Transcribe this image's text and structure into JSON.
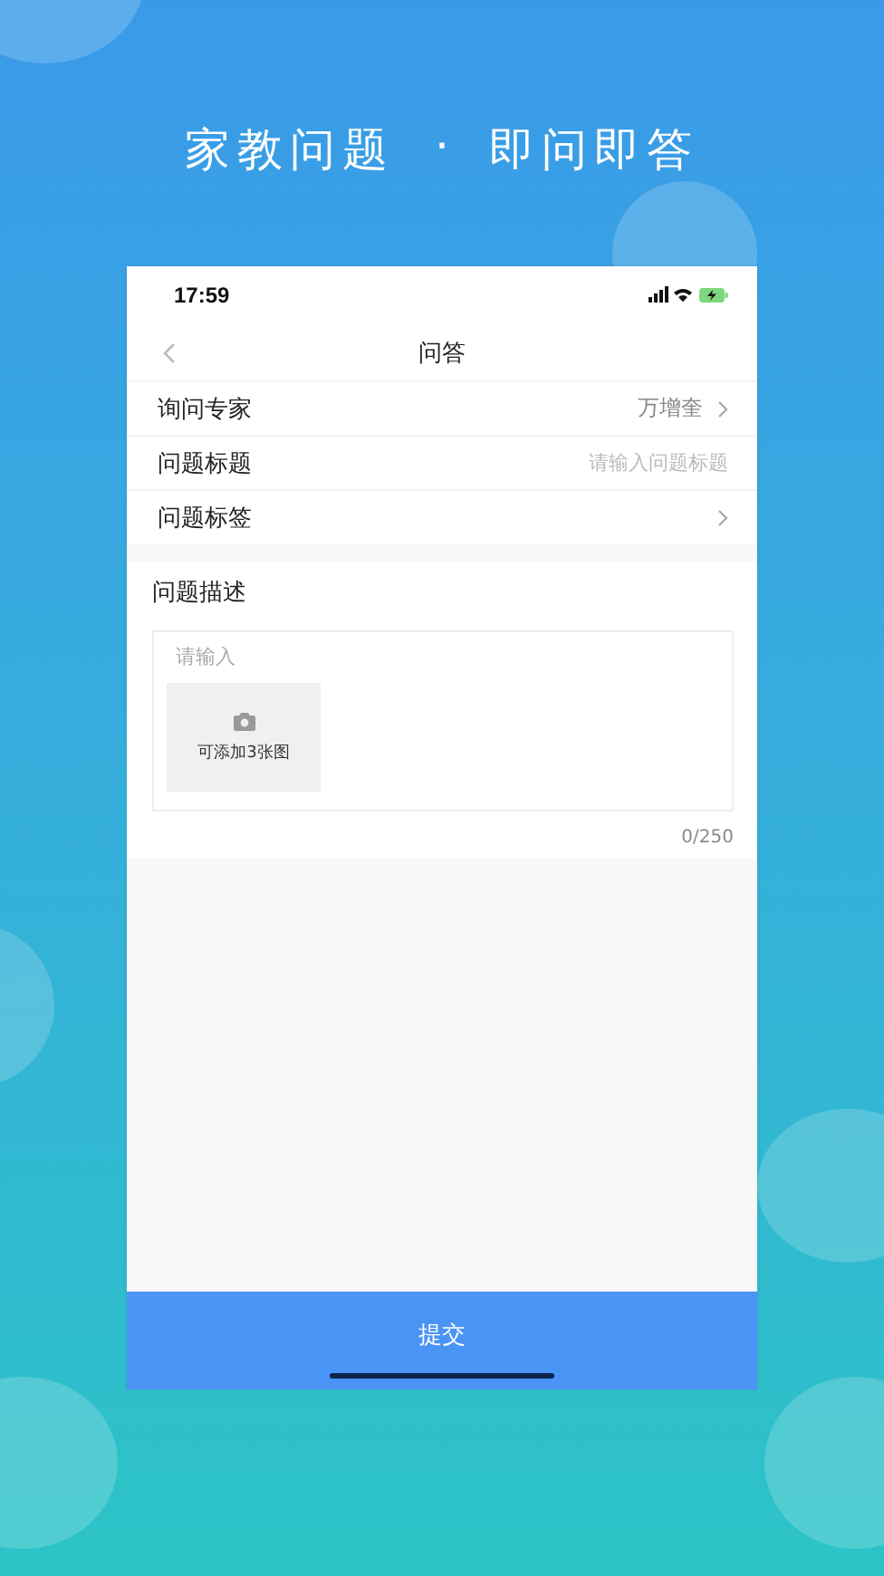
{
  "banner": {
    "title": "家教问题",
    "separator": "·",
    "subtitle": "即问即答"
  },
  "status_bar": {
    "time": "17:59"
  },
  "nav": {
    "title": "问答"
  },
  "form_rows": [
    {
      "kind": "link",
      "label": "询问专家",
      "value": "万增奎"
    },
    {
      "kind": "input",
      "label": "问题标题",
      "placeholder": "请输入问题标题"
    },
    {
      "kind": "link",
      "label": "问题标签"
    }
  ],
  "description": {
    "title": "问题描述",
    "placeholder": "请输入",
    "upload_label": "可添加3张图",
    "counter": "0/250"
  },
  "submit_button": "提交"
}
